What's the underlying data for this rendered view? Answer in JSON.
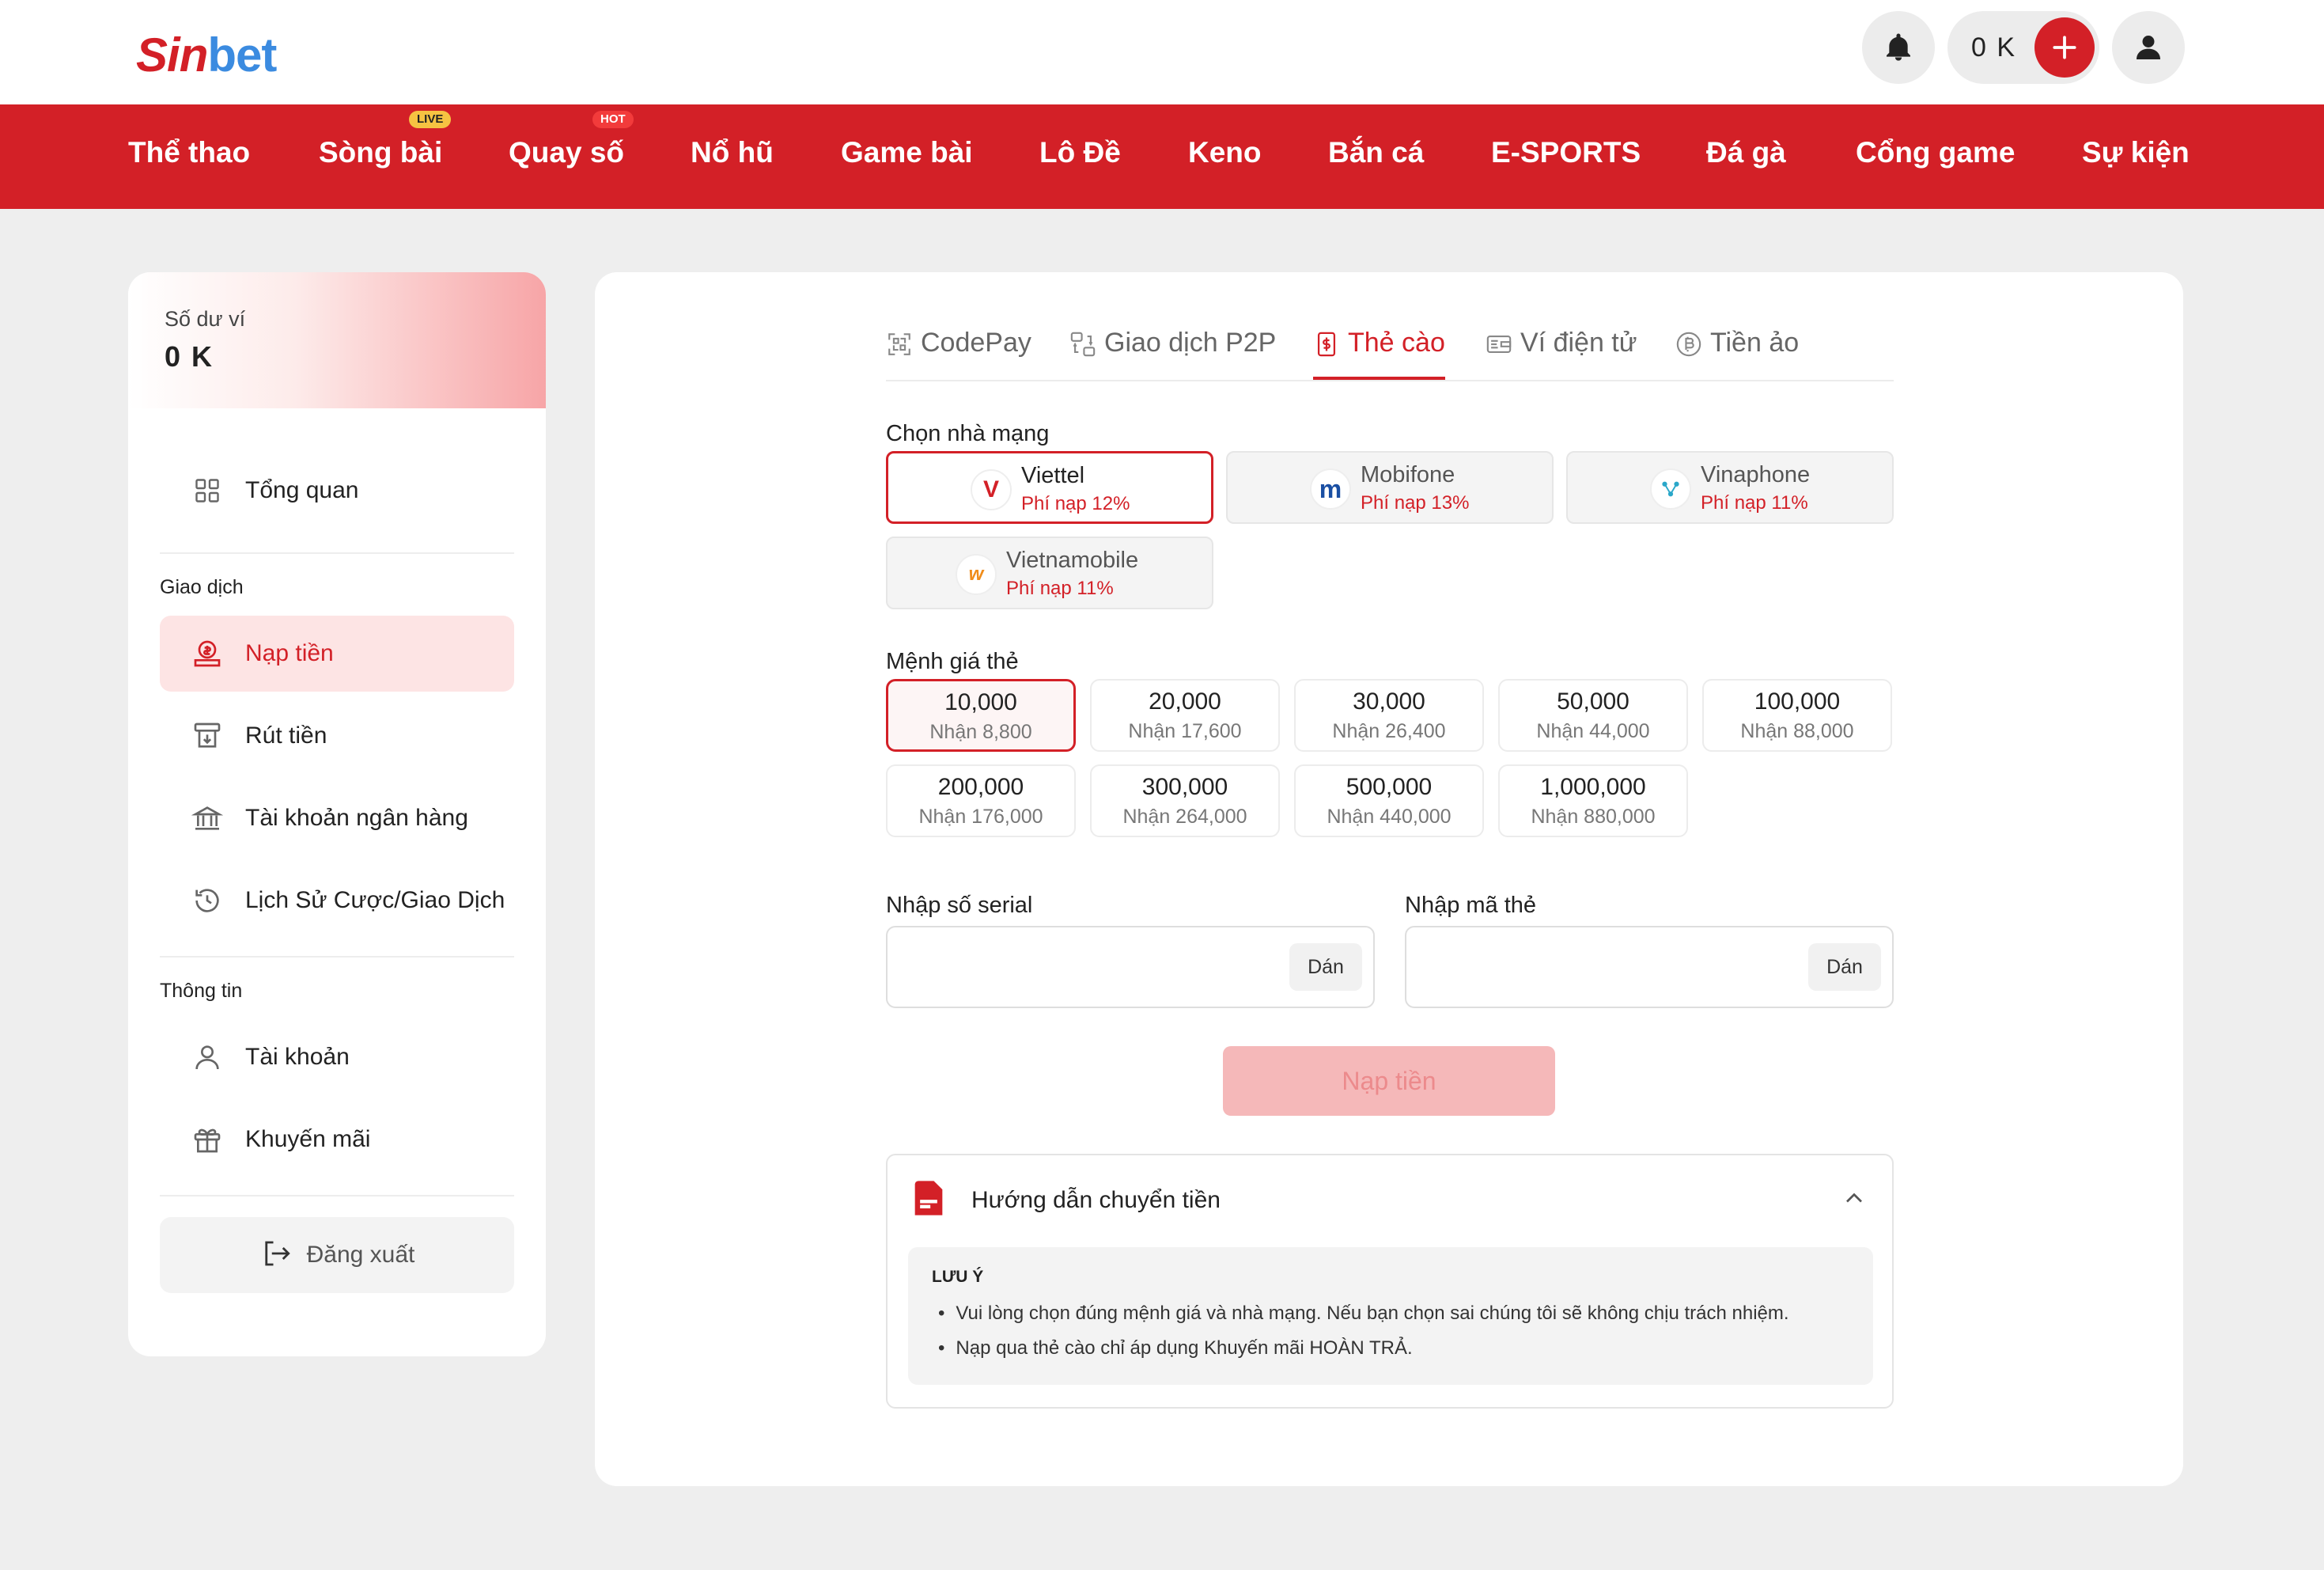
{
  "header": {
    "logo_part1": "Sin",
    "logo_part2": "bet",
    "balance": "0 K"
  },
  "nav": {
    "items": [
      {
        "label": "Thể thao"
      },
      {
        "label": "Sòng bài",
        "badge": "LIVE"
      },
      {
        "label": "Quay số",
        "badge": "HOT"
      },
      {
        "label": "Nổ hũ"
      },
      {
        "label": "Game bài"
      },
      {
        "label": "Lô Đề"
      },
      {
        "label": "Keno"
      },
      {
        "label": "Bắn cá"
      },
      {
        "label": "E-SPORTS"
      },
      {
        "label": "Đá gà"
      },
      {
        "label": "Cổng game"
      },
      {
        "label": "Sự kiện"
      }
    ]
  },
  "sidebar": {
    "wallet_label": "Số dư ví",
    "wallet_amount": "0 K",
    "overview": "Tổng quan",
    "section_transactions": "Giao dịch",
    "deposit": "Nạp tiền",
    "withdraw": "Rút tiền",
    "bank_account": "Tài khoản ngân hàng",
    "history": "Lịch Sử Cược/Giao Dịch",
    "section_info": "Thông tin",
    "account": "Tài khoản",
    "promotions": "Khuyến mãi",
    "logout": "Đăng xuất"
  },
  "tabs": [
    {
      "label": "CodePay",
      "icon": "scan-icon"
    },
    {
      "label": "Giao dịch P2P",
      "icon": "p2p-icon"
    },
    {
      "label": "Thẻ cào",
      "icon": "card-dollar-icon",
      "active": true
    },
    {
      "label": "Ví điện tử",
      "icon": "wallet-icon"
    },
    {
      "label": "Tiền ảo",
      "icon": "bitcoin-icon"
    }
  ],
  "carrier_section": {
    "label": "Chọn nhà mạng",
    "carriers": [
      {
        "name": "Viettel",
        "fee": "Phí nạp 12%",
        "selected": true
      },
      {
        "name": "Mobifone",
        "fee": "Phí nạp 13%"
      },
      {
        "name": "Vinaphone",
        "fee": "Phí nạp 11%"
      },
      {
        "name": "Vietnamobile",
        "fee": "Phí nạp 11%"
      }
    ]
  },
  "denomination_section": {
    "label": "Mệnh giá thẻ",
    "items": [
      {
        "value": "10,000",
        "receive": "Nhận 8,800",
        "selected": true
      },
      {
        "value": "20,000",
        "receive": "Nhận 17,600"
      },
      {
        "value": "30,000",
        "receive": "Nhận 26,400"
      },
      {
        "value": "50,000",
        "receive": "Nhận 44,000"
      },
      {
        "value": "100,000",
        "receive": "Nhận 88,000"
      },
      {
        "value": "200,000",
        "receive": "Nhận 176,000"
      },
      {
        "value": "300,000",
        "receive": "Nhận 264,000"
      },
      {
        "value": "500,000",
        "receive": "Nhận 440,000"
      },
      {
        "value": "1,000,000",
        "receive": "Nhận 880,000"
      }
    ]
  },
  "serial_field": {
    "label": "Nhập số serial",
    "value": "",
    "paste": "Dán"
  },
  "code_field": {
    "label": "Nhập mã thẻ",
    "value": "",
    "paste": "Dán"
  },
  "submit_label": "Nạp tiền",
  "guide": {
    "title": "Hướng dẫn chuyển tiền",
    "note_title": "LƯU Ý",
    "notes": [
      "Vui lòng chọn đúng mệnh giá và nhà mạng. Nếu bạn chọn sai chúng tôi sẽ không chịu trách nhiệm.",
      "Nạp qua thẻ cào chỉ áp dụng Khuyến mãi HOÀN TRẢ."
    ]
  },
  "colors": {
    "brand_red": "#d32027",
    "active_bg": "#fde4e4",
    "disabled_button": "#f5b8b9"
  }
}
